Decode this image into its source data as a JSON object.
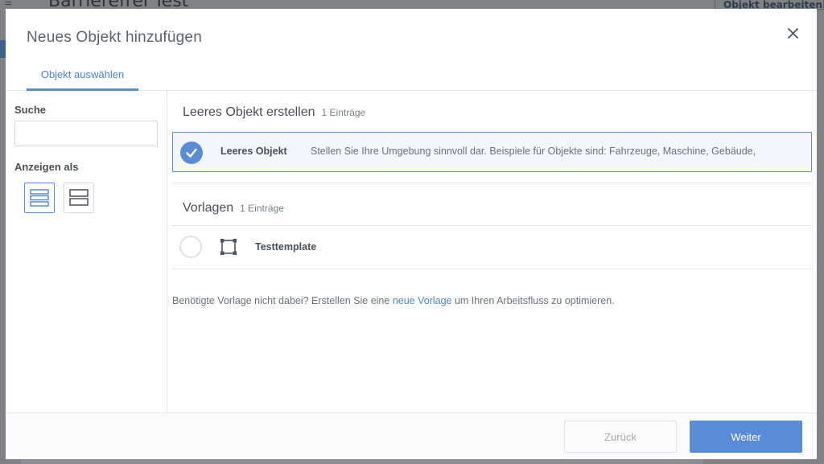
{
  "background": {
    "title": "Barrierefrei Test",
    "edit_button": "Objekt bearbeiten"
  },
  "modal": {
    "title": "Neues Objekt hinzufügen",
    "tabs": [
      {
        "label": "Objekt auswählen",
        "active": true
      }
    ]
  },
  "sidebar": {
    "search_label": "Suche",
    "search_value": "",
    "view_label": "Anzeigen als",
    "view_modes": [
      {
        "icon": "list-view-icon",
        "active": true
      },
      {
        "icon": "card-view-icon",
        "active": false
      }
    ]
  },
  "sections": {
    "empty": {
      "title": "Leeres Objekt erstellen",
      "count": "1 Einträge",
      "items": [
        {
          "name": "Leeres Objekt",
          "description": "Stellen Sie Ihre Umgebung sinnvoll dar. Beispiele für Objekte sind: Fahrzeuge, Maschine, Gebäude,",
          "selected": true
        }
      ]
    },
    "templates": {
      "title": "Vorlagen",
      "count": "1 Einträge",
      "items": [
        {
          "name": "Testtemplate",
          "icon": "bounding-box-icon",
          "selected": false
        }
      ]
    }
  },
  "hint": {
    "before": "Benötigte Vorlage nicht dabei? Erstellen Sie eine ",
    "link": "neue Vorlage",
    "after": " um Ihren Arbeitsfluss zu optimieren."
  },
  "footer": {
    "back_label": "Zurück",
    "next_label": "Weiter"
  },
  "colors": {
    "accent": "#5a8bd6",
    "overlay": "#7f8185"
  }
}
